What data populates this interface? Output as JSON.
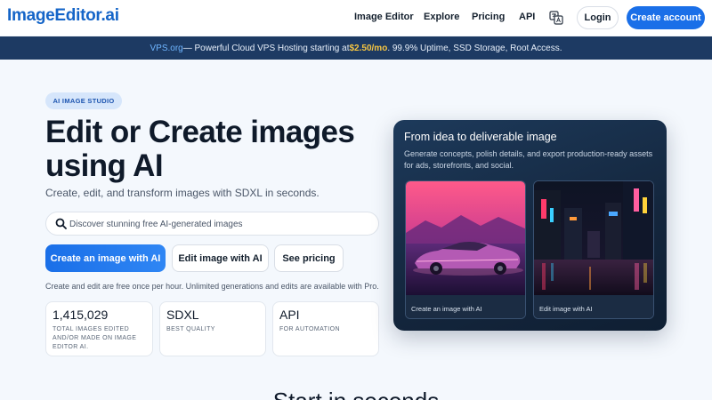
{
  "header": {
    "logo": "ImageEditor.ai",
    "nav": [
      "Image Editor",
      "Explore",
      "Pricing",
      "API"
    ],
    "translate_icon": "translate-icon",
    "login": "Login",
    "create_account": "Create account"
  },
  "banner": {
    "brand": "VPS.org",
    "text_before_price": " — Powerful Cloud VPS Hosting starting at ",
    "price": "$2.50/mo",
    "text_after_price": ". 99.9% Uptime, SSD Storage, Root Access."
  },
  "hero": {
    "badge": "AI IMAGE STUDIO",
    "title_line1": "Edit or Create images",
    "title_line2": "using AI",
    "subtitle": "Create, edit, and transform images with SDXL in seconds.",
    "search": {
      "icon": "search-icon",
      "placeholder": "Discover stunning free AI-generated images"
    },
    "buttons": {
      "create": "Create an image with AI",
      "edit": "Edit image with AI",
      "pricing": "See pricing"
    },
    "note": "Create and edit are free once per hour. Unlimited generations and edits are available with Pro.",
    "stats": [
      {
        "value": "1,415,029",
        "label": "TOTAL IMAGES EDITED AND/OR MADE ON IMAGE EDITOR AI."
      },
      {
        "value": "SDXL",
        "label": "BEST QUALITY"
      },
      {
        "value": "API",
        "label": "FOR AUTOMATION"
      }
    ]
  },
  "card": {
    "title": "From idea to deliverable image",
    "description": "Generate concepts, polish details, and export production-ready assets for ads, storefronts, and social.",
    "thumbs": [
      {
        "label": "Create an image with AI"
      },
      {
        "label": "Edit image with AI"
      }
    ]
  },
  "section": {
    "heading": "Start in seconds"
  },
  "colors": {
    "accent": "#1a6fe8",
    "banner_bg": "#1d3a63",
    "banner_price": "#f5c542",
    "card_bg": "#14263d"
  }
}
